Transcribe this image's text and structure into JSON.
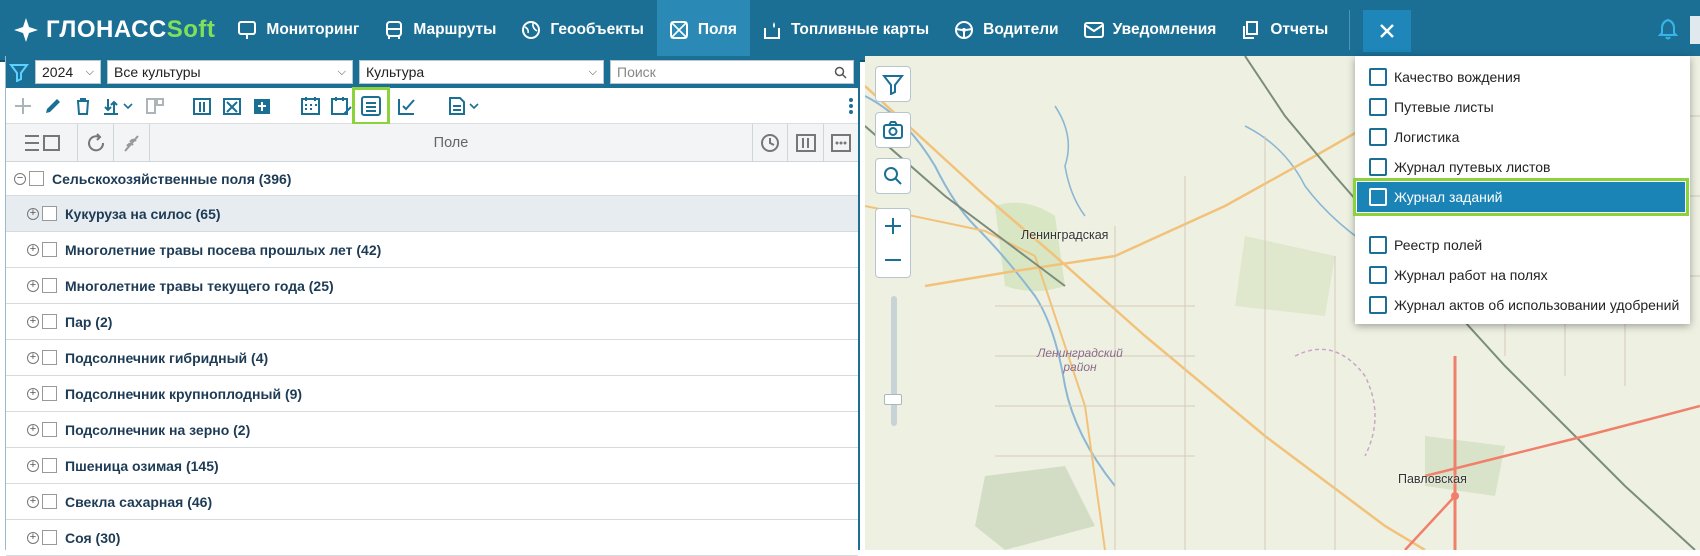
{
  "brand": {
    "part1": "ГЛОНАСС",
    "part2": "Soft"
  },
  "nav": [
    {
      "label": "Мониторинг",
      "icon": "monitor-pin-icon"
    },
    {
      "label": "Маршруты",
      "icon": "bus-icon"
    },
    {
      "label": "Геообъекты",
      "icon": "globe-icon"
    },
    {
      "label": "Поля",
      "icon": "field-icon",
      "active": true
    },
    {
      "label": "Топливные карты",
      "icon": "fuel-card-icon"
    },
    {
      "label": "Водители",
      "icon": "steering-wheel-icon"
    },
    {
      "label": "Уведомления",
      "icon": "envelope-icon"
    },
    {
      "label": "Отчеты",
      "icon": "reports-icon"
    }
  ],
  "filters": {
    "year": "2024",
    "crops": "Все культуры",
    "group_by": "Культура",
    "search_placeholder": "Поиск"
  },
  "table": {
    "column_title": "Поле"
  },
  "tree": {
    "root": "Сельскохозяйственные поля (396)",
    "items": [
      "Кукуруза на силос (65)",
      "Многолетние травы посева прошлых лет (42)",
      "Многолетние травы текущего года (25)",
      "Пар (2)",
      "Подсолнечник гибридный (4)",
      "Подсолнечник крупноплодный (9)",
      "Подсолнечник на зерно (2)",
      "Пшеница озимая (145)",
      "Свекла сахарная (46)",
      "Соя (30)"
    ]
  },
  "map": {
    "towns": [
      "Ленинградская",
      "Павловская"
    ],
    "district": "Ленинградский район"
  },
  "dropdown": {
    "group1": [
      "Качество вождения",
      "Путевые листы",
      "Логистика",
      "Журнал путевых листов",
      "Журнал заданий"
    ],
    "group2": [
      "Реестр полей",
      "Журнал работ на полях",
      "Журнал актов об использовании удобрений"
    ],
    "active": "Журнал заданий"
  },
  "colors": {
    "primary": "#1b6f95",
    "active_nav": "#2b8ab5",
    "highlight": "#8cd23a",
    "brand_green": "#7fe05a"
  }
}
